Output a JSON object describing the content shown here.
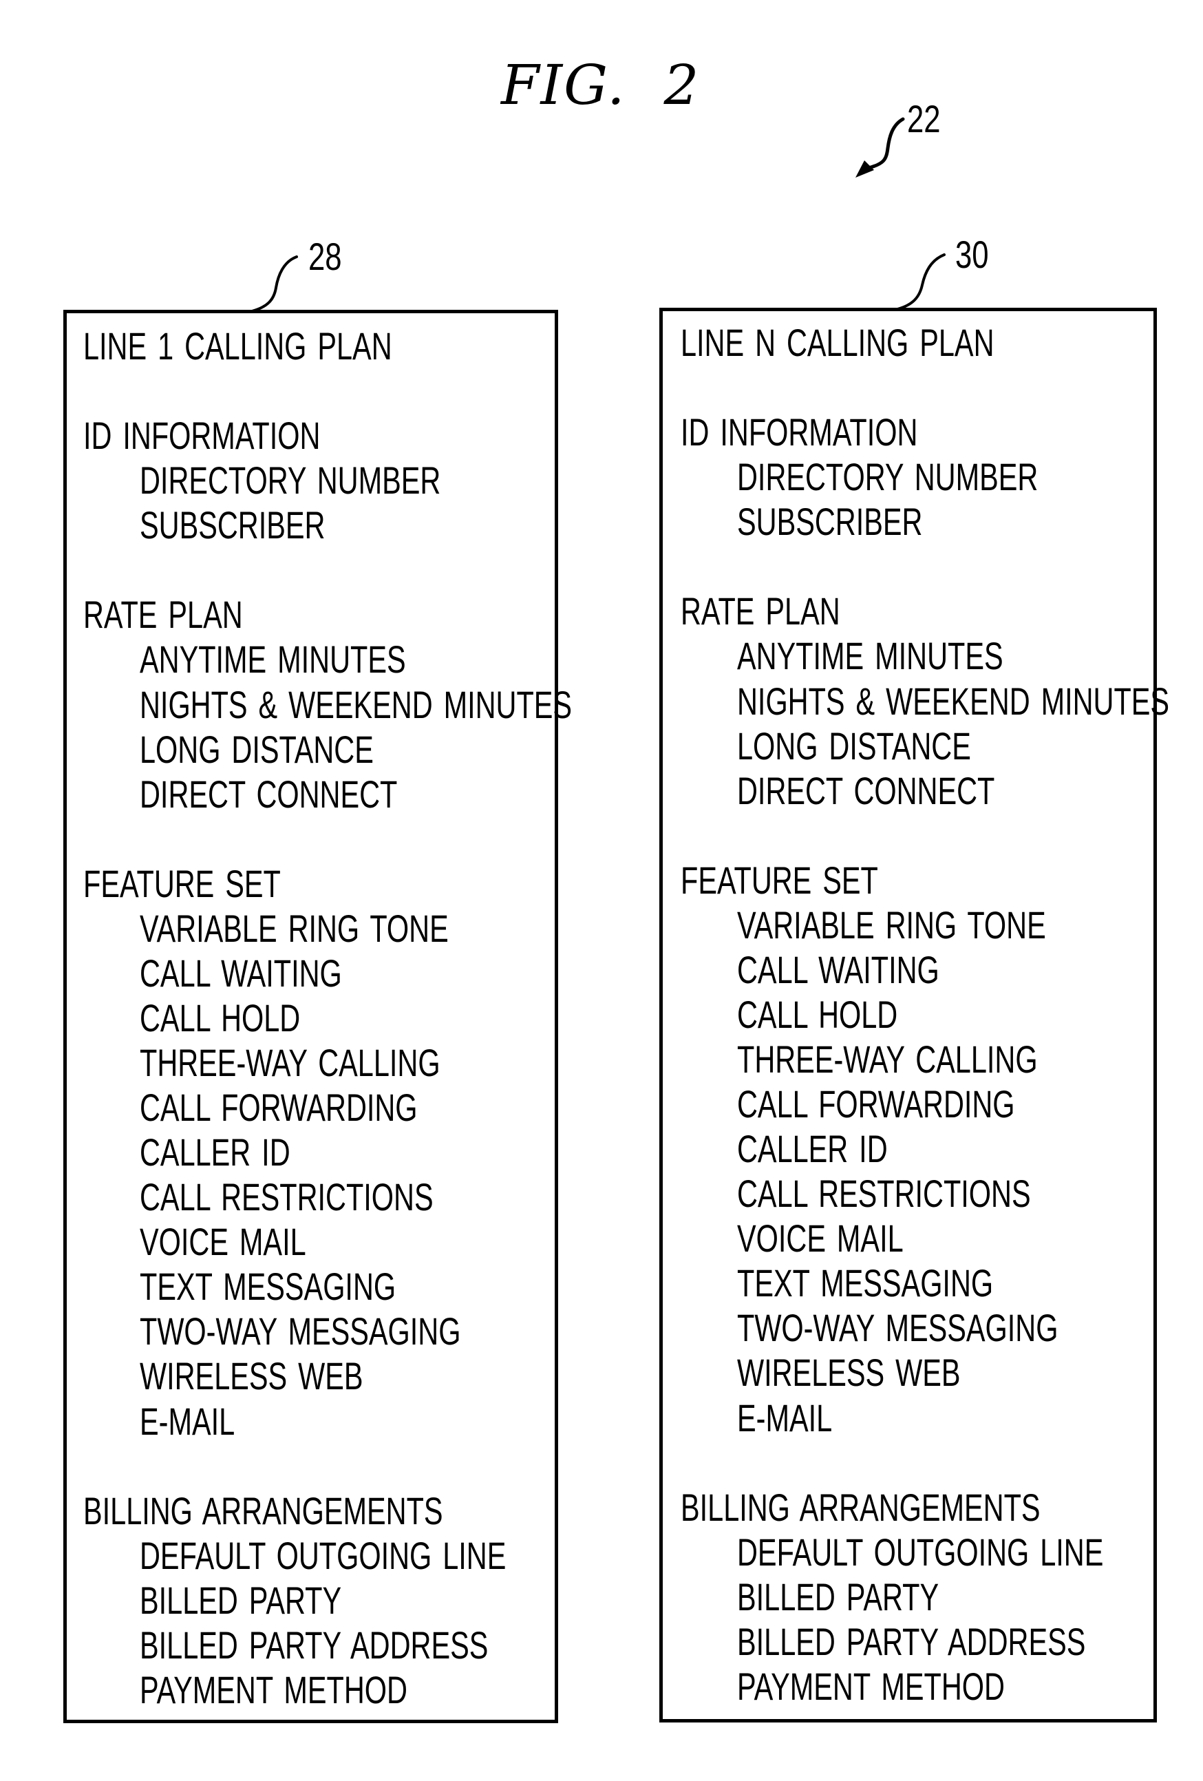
{
  "figure": {
    "title": "FIG.  2",
    "reference_numerals": {
      "assembly": "22",
      "left_panel": "28",
      "right_panel": "30"
    }
  },
  "panels": [
    {
      "id": "line-1",
      "title": "LINE 1 CALLING PLAN",
      "sections": [
        {
          "heading": "ID INFORMATION",
          "items": [
            "DIRECTORY NUMBER",
            "SUBSCRIBER"
          ]
        },
        {
          "heading": "RATE PLAN",
          "items": [
            "ANYTIME MINUTES",
            "NIGHTS & WEEKEND MINUTES",
            "LONG DISTANCE",
            "DIRECT CONNECT"
          ]
        },
        {
          "heading": "FEATURE SET",
          "items": [
            "VARIABLE RING TONE",
            "CALL WAITING",
            "CALL HOLD",
            "THREE-WAY CALLING",
            "CALL FORWARDING",
            "CALLER ID",
            "CALL RESTRICTIONS",
            "VOICE MAIL",
            "TEXT MESSAGING",
            "TWO-WAY MESSAGING",
            "WIRELESS WEB",
            "E-MAIL"
          ]
        },
        {
          "heading": "BILLING ARRANGEMENTS",
          "items": [
            "DEFAULT OUTGOING LINE",
            "BILLED PARTY",
            "BILLED PARTY ADDRESS",
            "PAYMENT METHOD"
          ]
        }
      ]
    },
    {
      "id": "line-n",
      "title": "LINE N CALLING PLAN",
      "sections": [
        {
          "heading": "ID INFORMATION",
          "items": [
            "DIRECTORY NUMBER",
            "SUBSCRIBER"
          ]
        },
        {
          "heading": "RATE PLAN",
          "items": [
            "ANYTIME MINUTES",
            "NIGHTS & WEEKEND MINUTES",
            "LONG DISTANCE",
            "DIRECT CONNECT"
          ]
        },
        {
          "heading": "FEATURE SET",
          "items": [
            "VARIABLE RING TONE",
            "CALL WAITING",
            "CALL HOLD",
            "THREE-WAY CALLING",
            "CALL FORWARDING",
            "CALLER ID",
            "CALL RESTRICTIONS",
            "VOICE MAIL",
            "TEXT MESSAGING",
            "TWO-WAY MESSAGING",
            "WIRELESS WEB",
            "E-MAIL"
          ]
        },
        {
          "heading": "BILLING ARRANGEMENTS",
          "items": [
            "DEFAULT OUTGOING LINE",
            "BILLED PARTY",
            "BILLED PARTY ADDRESS",
            "PAYMENT METHOD"
          ]
        }
      ]
    }
  ]
}
